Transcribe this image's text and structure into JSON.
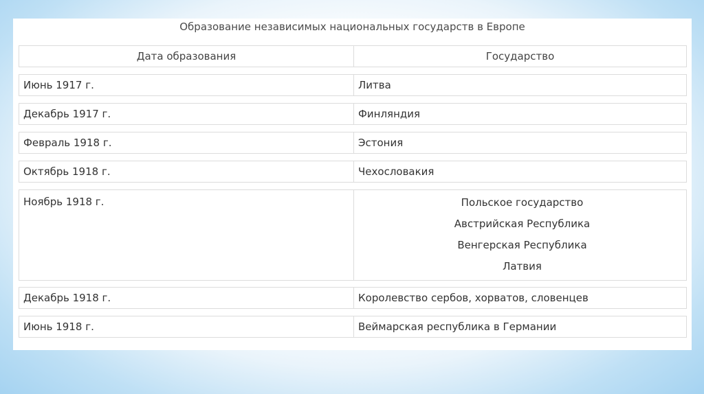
{
  "table": {
    "caption": "Образование независимых национальных государств в Европе",
    "headers": [
      "Дата образования",
      "Государство"
    ],
    "rows": [
      {
        "date": "Июнь 1917 г.",
        "states": [
          "Литва"
        ]
      },
      {
        "date": "Декабрь 1917 г.",
        "states": [
          "Финляндия"
        ]
      },
      {
        "date": "Февраль 1918 г.",
        "states": [
          "Эстония"
        ]
      },
      {
        "date": "Октябрь 1918 г.",
        "states": [
          "Чехословакия"
        ]
      },
      {
        "date": "Ноябрь 1918 г.",
        "states": [
          "Польское государство",
          "Австрийская Республика",
          "Венгерская Республика",
          "Латвия"
        ]
      },
      {
        "date": "Декабрь 1918 г.",
        "states": [
          "Королевство сербов, хорватов, словенцев"
        ]
      },
      {
        "date": "Июнь 1918 г.",
        "states": [
          "Веймарская республика в Германии"
        ]
      }
    ]
  }
}
